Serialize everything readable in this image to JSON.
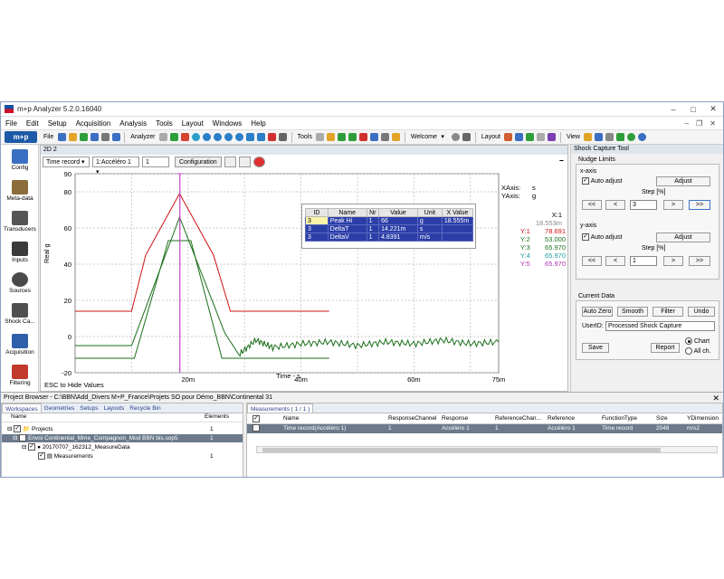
{
  "window": {
    "title": "m+p Analyzer 5.2.0.16040"
  },
  "menu": [
    "File",
    "Edit",
    "Setup",
    "Acquisition",
    "Analysis",
    "Tools",
    "Layout",
    "Windows",
    "Help"
  ],
  "toolbar": {
    "logo": "m+p",
    "file": "File",
    "analyzer": "Analyzer",
    "tools": "Tools",
    "welcome": "Welcome",
    "layout": "Layout",
    "view": "View"
  },
  "sidebar": {
    "items": [
      {
        "label": "Config",
        "icon": "config-icon",
        "color": "#3b6fc2"
      },
      {
        "label": "Meta-data",
        "icon": "metadata-icon",
        "color": "#8a6d3b"
      },
      {
        "label": "Transducers",
        "icon": "transducer-icon",
        "color": "#555555"
      },
      {
        "label": "Inputs",
        "icon": "inputs-icon",
        "color": "#3a3a3a"
      },
      {
        "label": "Sources",
        "icon": "sources-icon",
        "color": "#4a4a4a"
      },
      {
        "label": "Shock Ca...",
        "icon": "shock-icon",
        "color": "#505050"
      },
      {
        "label": "Acquisition",
        "icon": "acquisition-icon",
        "color": "#2f5fa8"
      },
      {
        "label": "Filtering",
        "icon": "filtering-icon",
        "color": "#c0392b"
      }
    ]
  },
  "panel": {
    "title": "2D 2",
    "select_type": "Time record",
    "select_channel": "1:Accéléro 1",
    "channel_number": "1",
    "config_label": "Configuration"
  },
  "axes": {
    "xaxis_label": "XAxis:",
    "xaxis_unit": "s",
    "yaxis_label": "YAxis:",
    "yaxis_unit": "g",
    "x_title": "Time - s",
    "y_title": "Real g",
    "esc_hint": "ESC to Hide Values"
  },
  "cursor": {
    "x_label": "X:1",
    "x_value": "18.553m",
    "values": [
      {
        "label": "Y:1",
        "value": "78.691",
        "color": "#d01010"
      },
      {
        "label": "Y:2",
        "value": "53.000",
        "color": "#1a6e1a"
      },
      {
        "label": "Y:3",
        "value": "65.970",
        "color": "#1a6e1a"
      },
      {
        "label": "Y:4",
        "value": "65.970",
        "color": "#1aa0a0"
      },
      {
        "label": "Y:5",
        "value": "65.970",
        "color": "#b030b0"
      }
    ]
  },
  "data_table": {
    "headers": [
      "ID",
      "Name",
      "Nr",
      "Value",
      "Unit",
      "X Value"
    ],
    "rows": [
      [
        "3",
        "Peak Hi",
        "1",
        "66",
        "g",
        "18.555m"
      ],
      [
        "3",
        "DeltaT",
        "1",
        "14.221m",
        "s",
        ""
      ],
      [
        "3",
        "DeltaV",
        "1",
        "4.8391",
        "m/s",
        ""
      ]
    ]
  },
  "chart_data": {
    "type": "line",
    "xlabel": "Time - s",
    "ylabel": "Real g",
    "xlim": [
      0,
      0.075
    ],
    "ylim": [
      -20,
      90
    ],
    "x_ticks": [
      "20m",
      "40m",
      "60m",
      "75m"
    ],
    "y_ticks": [
      "-20",
      "0",
      "20",
      "40",
      "60",
      "80",
      "90"
    ],
    "cursor_x": 0.01855,
    "series": [
      {
        "color": "#1a6e1a",
        "x": [
          0,
          0.01,
          0.0185,
          0.0265,
          0.029,
          0.032,
          0.035,
          0.04,
          0.045,
          0.05,
          0.055,
          0.06,
          0.065,
          0.07,
          0.075
        ],
        "y": [
          -5,
          -5,
          66,
          2,
          -10,
          -2,
          -6,
          -4,
          -3,
          -5,
          -3,
          -4,
          -2,
          -4,
          -3
        ]
      },
      {
        "color": "#d01010",
        "x": [
          0,
          0.01,
          0.0125,
          0.0185,
          0.0245,
          0.0275,
          0.045
        ],
        "y": [
          14,
          14,
          45,
          79,
          45,
          14,
          14
        ]
      },
      {
        "color": "#1a6e1a",
        "x": [
          0,
          0.0105,
          0.0165,
          0.0205,
          0.026,
          0.045
        ],
        "y": [
          -12,
          -12,
          53,
          53,
          -12,
          -12
        ]
      }
    ]
  },
  "shock_tool": {
    "title": "Shock Capture Tool",
    "nudge_title": "Nudge Limits",
    "xaxis": "x-axis",
    "yaxis": "y-axis",
    "auto_adjust": "Auto adjust",
    "adjust": "Adjust",
    "step": "Step [%]",
    "x_step": "3",
    "y_step": "1",
    "nudge_buttons": [
      "<<",
      "<",
      ">",
      ">>"
    ],
    "current_data": "Current Data",
    "auto_zero": "Auto Zero",
    "smooth": "Smooth",
    "filter": "Filter",
    "undo": "Undo",
    "userid_label": "UserID:",
    "userid_value": "Processed Shock Capture",
    "save": "Save",
    "report": "Report",
    "radio_chart": "Chart",
    "radio_all": "All ch."
  },
  "project_browser": {
    "title": "Project Browser - C:\\BBN\\Add_Divers M+P_France\\Projets SO pour Démo_BBN\\Continental 31",
    "tabs": [
      "Workspaces",
      "Geometries",
      "Setups",
      "Layouts",
      "Recycle Bin"
    ],
    "col_name": "Name",
    "col_elements": "Elements",
    "tree": [
      {
        "name": "Projects",
        "elements": "1"
      },
      {
        "name": "Envoi Continental_Mme_Compagnon_Mod BBN bis.sop5",
        "elements": "1"
      },
      {
        "name": "20170707_162312_MeasureData",
        "elements": ""
      },
      {
        "name": "Measurements",
        "elements": "1"
      }
    ]
  },
  "measurements": {
    "tab": "Measurements ( 1 / 1 )",
    "headers": [
      "Name",
      "ResponseChannel",
      "Response",
      "ReferenceChan...",
      "Reference",
      "FunctionType",
      "Size",
      "YDimension"
    ],
    "row": [
      "Time record(Accéléro 1)",
      "1",
      "Accéléro 1",
      "1",
      "Accéléro 1",
      "Time record",
      "2048",
      "m/s2"
    ]
  }
}
